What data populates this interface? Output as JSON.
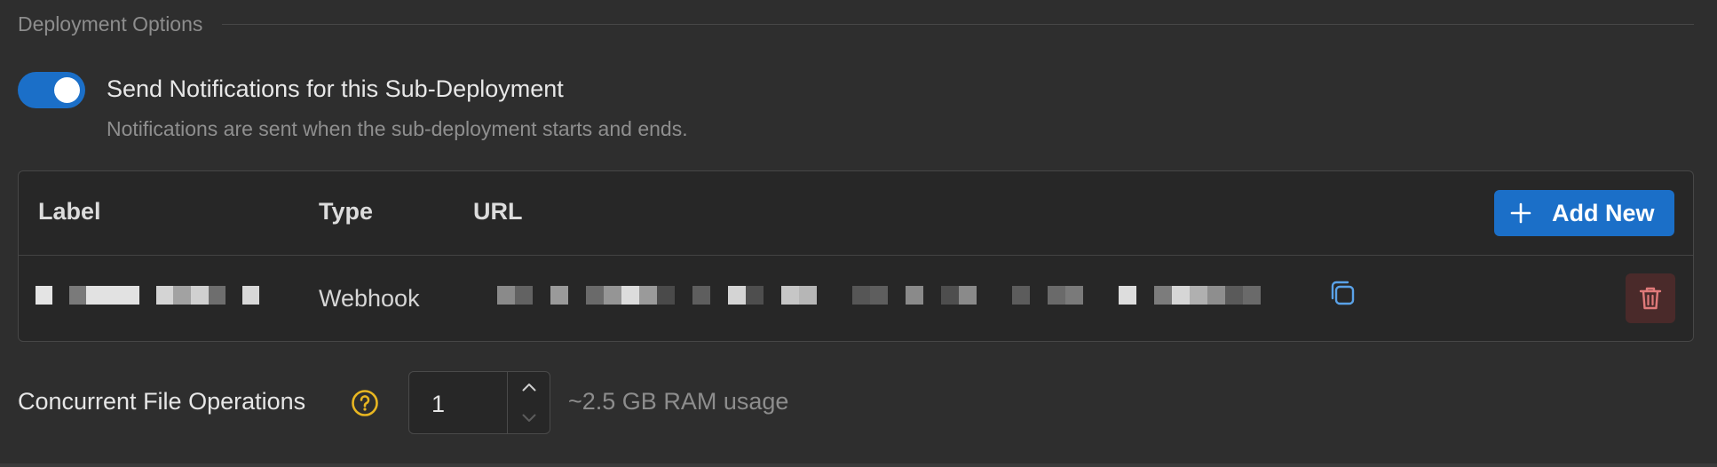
{
  "section": {
    "title": "Deployment Options"
  },
  "notifications": {
    "enabled": true,
    "label": "Send Notifications for this Sub-Deployment",
    "description": "Notifications are sent when the sub-deployment starts and ends."
  },
  "table": {
    "columns": [
      "Label",
      "Type",
      "URL"
    ],
    "add_button_label": "Add New",
    "rows": [
      {
        "label": "[redacted]",
        "type": "Webhook",
        "url": "[redacted]"
      }
    ]
  },
  "concurrency": {
    "label": "Concurrent File Operations",
    "value": "1",
    "hint": "~2.5 GB RAM usage"
  },
  "colors": {
    "accent": "#1b6fc8",
    "background": "#2e2e2e",
    "help_icon": "#e8b621",
    "delete": "#e07a7a",
    "copy": "#5aa2e8"
  },
  "icons": [
    "plus-icon",
    "copy-icon",
    "trash-icon",
    "question-circle-icon",
    "chevron-up-icon",
    "chevron-down-icon"
  ]
}
